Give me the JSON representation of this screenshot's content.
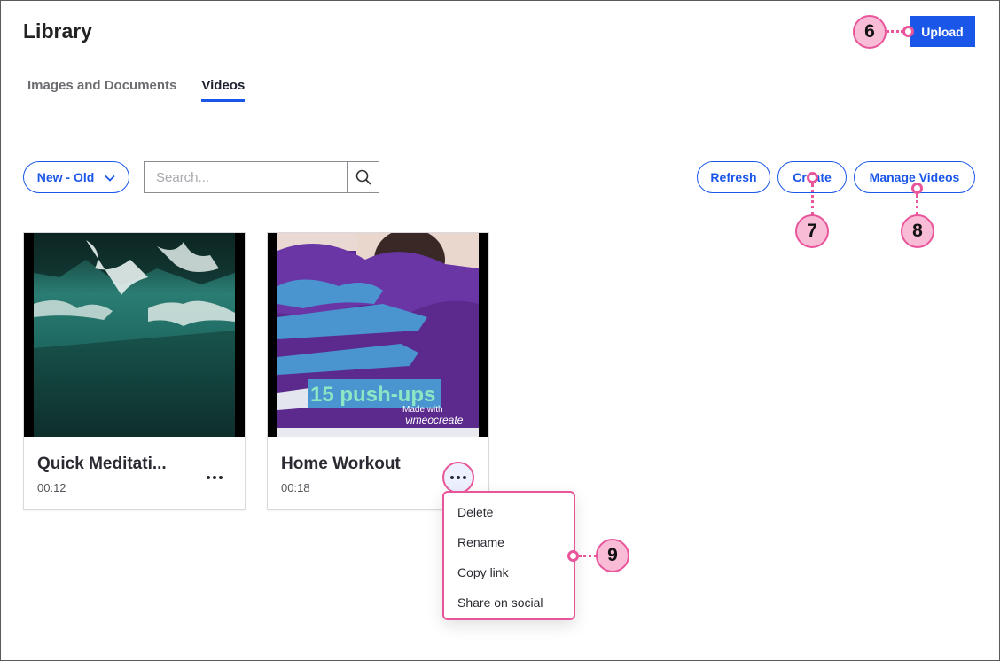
{
  "header": {
    "title": "Library",
    "upload_label": "Upload"
  },
  "tabs": [
    {
      "label": "Images and Documents",
      "active": false
    },
    {
      "label": "Videos",
      "active": true
    }
  ],
  "toolbar": {
    "sort_value": "New - Old",
    "search_placeholder": "Search...",
    "refresh_label": "Refresh",
    "create_label": "Create",
    "manage_label": "Manage Videos"
  },
  "videos": [
    {
      "title": "Quick Meditati...",
      "duration": "00:12"
    },
    {
      "title": "Home Workout",
      "duration": "00:18",
      "overlay_text": "15 push-ups",
      "watermark_line1": "Made with",
      "watermark_line2": "vimeocreate"
    }
  ],
  "context_menu": {
    "items": [
      "Delete",
      "Rename",
      "Copy link",
      "Share on social"
    ]
  },
  "callouts": [
    "6",
    "7",
    "8",
    "9"
  ],
  "colors": {
    "accent": "#1a56e8",
    "callout_border": "#e8559a",
    "callout_fill": "#f9bcd6"
  },
  "icons": {
    "sort": "chevron-down-icon",
    "search": "search-icon",
    "more": "more-horizontal-icon"
  }
}
